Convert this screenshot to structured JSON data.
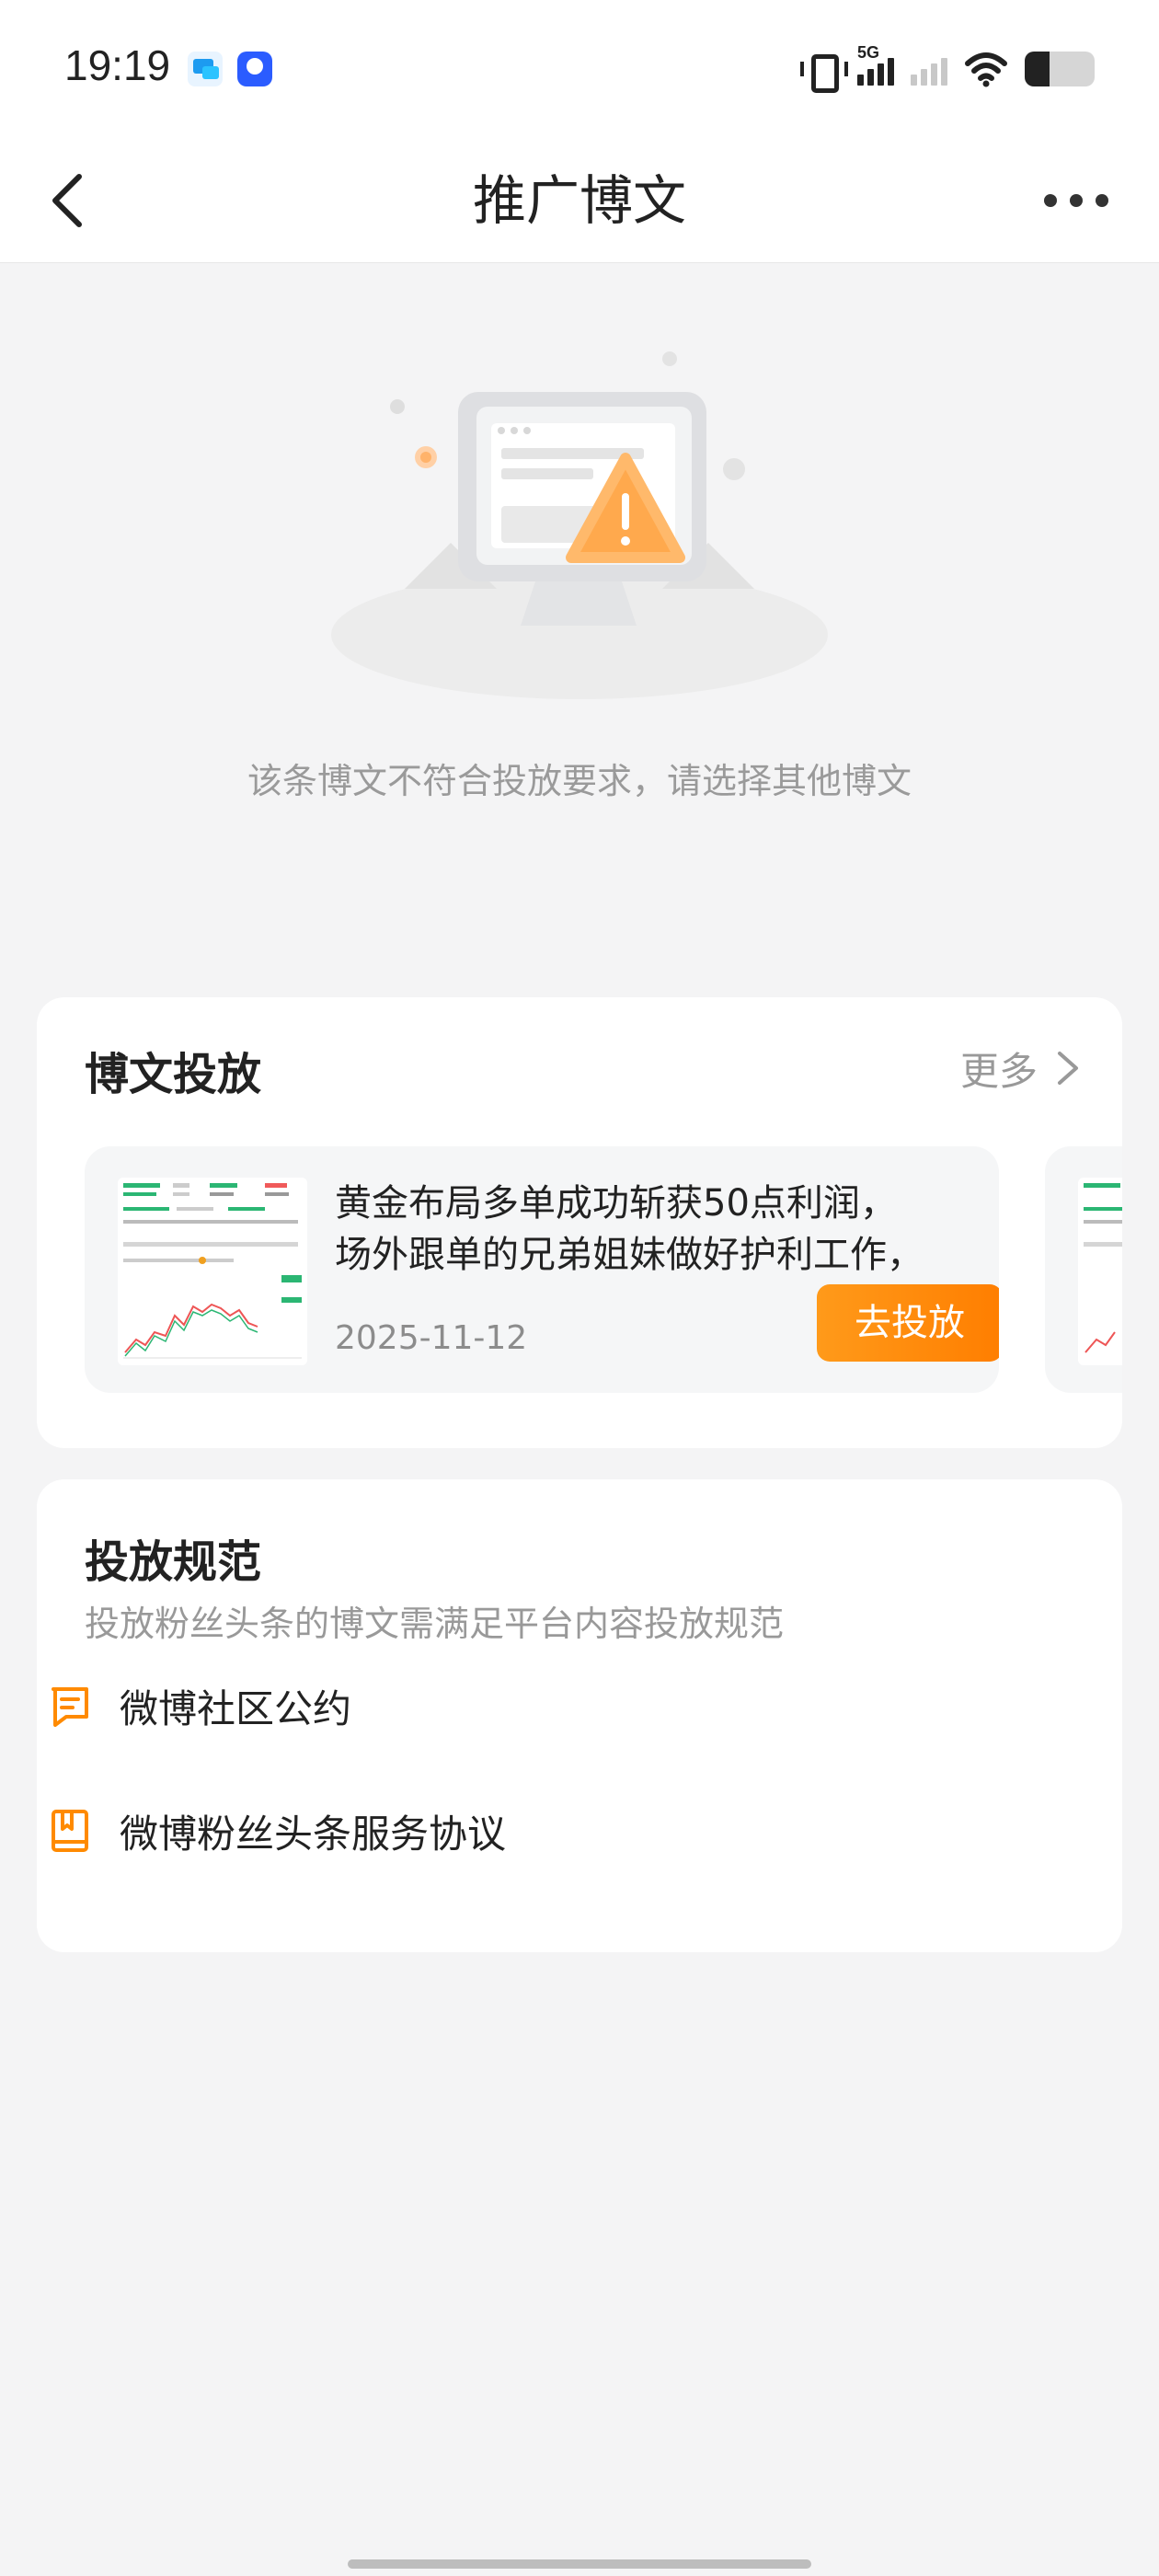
{
  "status_bar": {
    "time": "19:19",
    "network": "5G",
    "icons": [
      "chat-notification-icon",
      "baidu-app-icon",
      "vibrate-icon",
      "signal-icon",
      "wifi-icon",
      "battery-icon"
    ],
    "battery_level": 0.35
  },
  "header": {
    "title": "推广博文",
    "back_icon": "chevron-left-icon",
    "more_icon": "more-dots-icon"
  },
  "empty_state": {
    "illustration": "warning-monitor-illustration",
    "message": "该条博文不符合投放要求，请选择其他博文"
  },
  "delivery": {
    "title": "博文投放",
    "more_label": "更多",
    "posts": [
      {
        "text_line1": "黄金布局多单成功斩获50点利润，",
        "text_line2": "场外跟单的兄弟姐妹做好护利工作，",
        "date": "2025-11-12",
        "button_label": "去投放"
      }
    ]
  },
  "rules": {
    "title": "投放规范",
    "subtitle": "投放粉丝头条的博文需满足平台内容投放规范",
    "links": [
      {
        "label": "微博社区公约",
        "icon": "message-icon"
      },
      {
        "label": "微博粉丝头条服务协议",
        "icon": "bookmark-book-icon"
      }
    ]
  },
  "colors": {
    "accent": "#ff8a00",
    "background": "#f4f4f5",
    "card": "#ffffff"
  }
}
